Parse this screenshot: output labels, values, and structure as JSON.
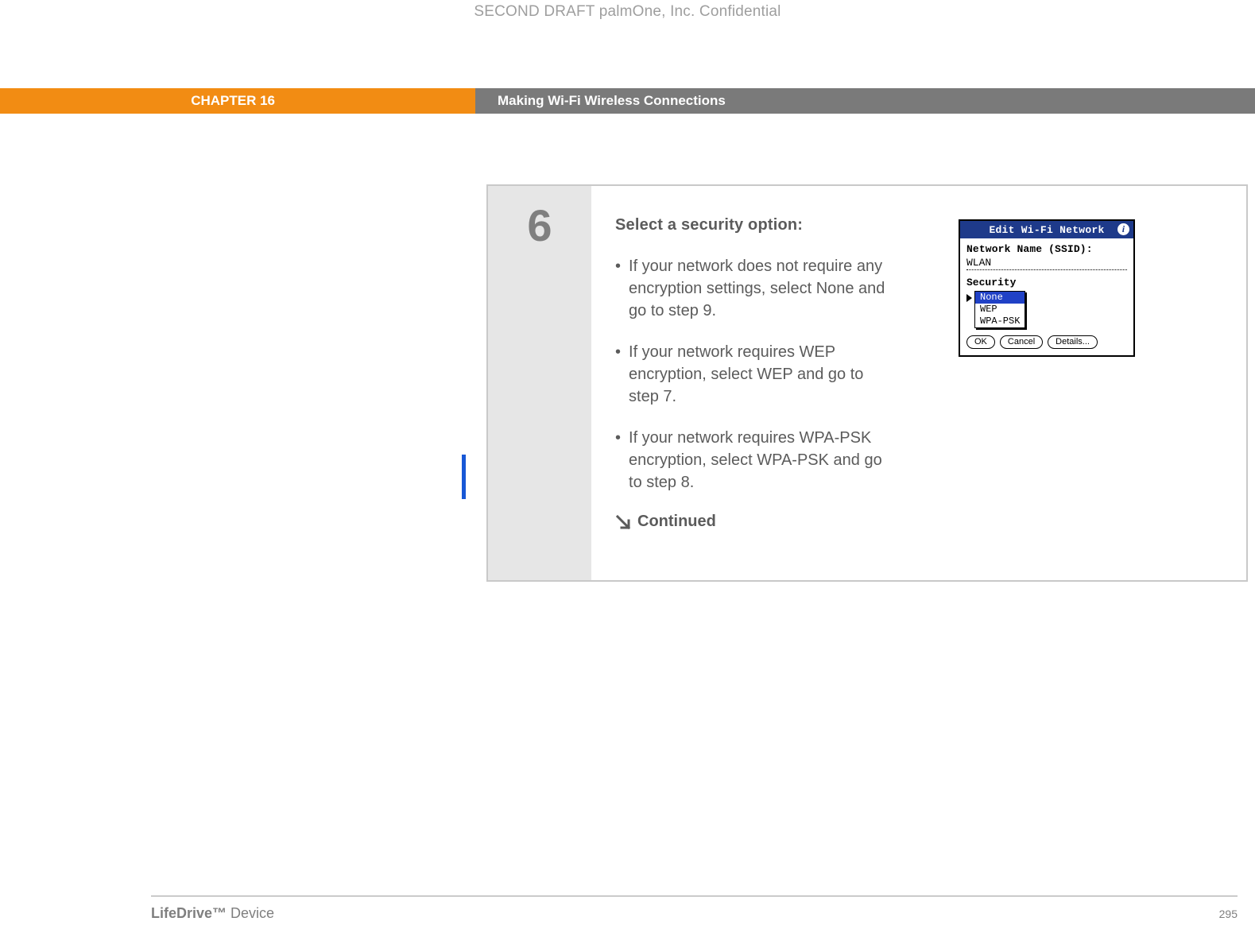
{
  "header": {
    "draft": "SECOND DRAFT palmOne, Inc.  Confidential"
  },
  "chapter": {
    "label": "CHAPTER 16",
    "title": "Making Wi-Fi Wireless Connections"
  },
  "step": {
    "number": "6",
    "instruction": "Select a security option:",
    "bullets": [
      "If your network does not require any encryption settings, select None and go to step 9.",
      "If your network requires WEP encryption, select WEP and go to step 7.",
      "If your network requires WPA-PSK encryption, select WPA-PSK and go to step 8."
    ],
    "continued": "Continued"
  },
  "palm": {
    "title": "Edit Wi-Fi Network",
    "ssid_label": "Network Name (SSID):",
    "ssid_value": "WLAN",
    "security_label": "Security",
    "options": [
      "None",
      "WEP",
      "WPA-PSK"
    ],
    "selected_index": 0,
    "buttons": {
      "ok": "OK",
      "cancel": "Cancel",
      "details": "Details..."
    }
  },
  "footer": {
    "product_bold": "LifeDrive™ ",
    "product_rest": "Device",
    "page": "295"
  }
}
